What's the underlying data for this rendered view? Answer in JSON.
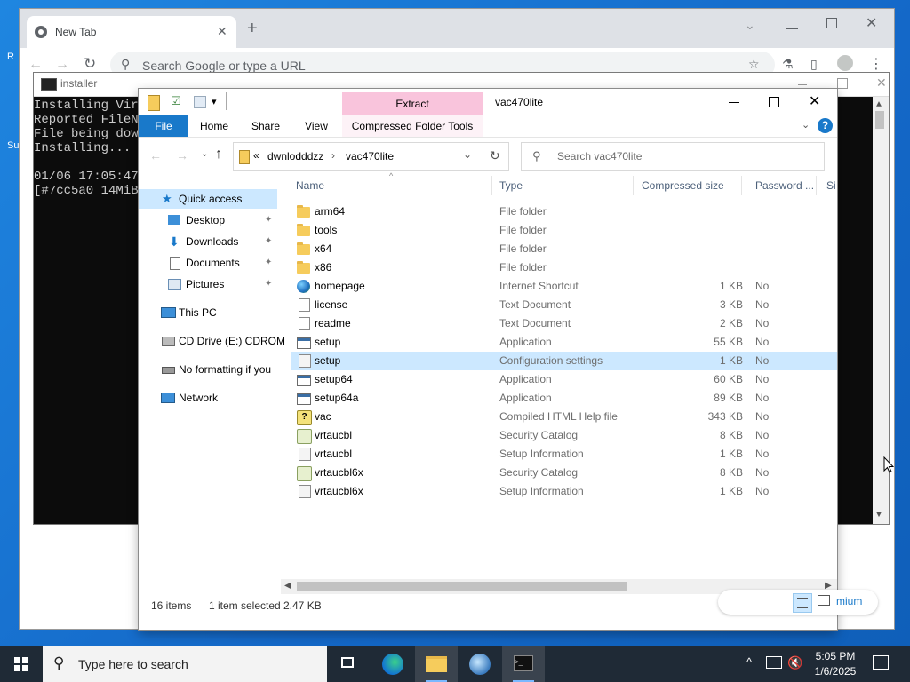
{
  "desktop": {
    "icon_fragment_1": "R",
    "icon_fragment_2": "Su"
  },
  "chrome": {
    "tab_title": "New Tab",
    "omnibox_placeholder": "Search Google or type a URL"
  },
  "cmd": {
    "title": "installer",
    "lines": [
      "Installing Virt",
      "Reported FileNa",
      "File being down",
      "Installing...",
      "",
      "01/06 17:05:47",
      "[#7cc5a0 14MiB/"
    ]
  },
  "explorer": {
    "title": "vac470lite",
    "ribbon": {
      "context_group": "Extract",
      "tabs": [
        "File",
        "Home",
        "Share",
        "View",
        "Compressed Folder Tools"
      ]
    },
    "address": {
      "prefix": "«",
      "crumbs": [
        "dwnlodddzz",
        "vac470lite"
      ]
    },
    "search_placeholder": "Search vac470lite",
    "nav": {
      "quick_access": "Quick access",
      "pinned": [
        "Desktop",
        "Downloads",
        "Documents",
        "Pictures"
      ],
      "this_pc": "This PC",
      "cd_drive": "CD Drive (E:) CDROM",
      "no_format": "No formatting if you",
      "network": "Network"
    },
    "columns": [
      "Name",
      "Type",
      "Compressed size",
      "Password ...",
      "Si"
    ],
    "files": [
      {
        "name": "arm64",
        "type": "File folder",
        "size": "",
        "password": "",
        "icon": "folder-icon"
      },
      {
        "name": "tools",
        "type": "File folder",
        "size": "",
        "password": "",
        "icon": "folder-icon"
      },
      {
        "name": "x64",
        "type": "File folder",
        "size": "",
        "password": "",
        "icon": "folder-icon"
      },
      {
        "name": "x86",
        "type": "File folder",
        "size": "",
        "password": "",
        "icon": "folder-icon"
      },
      {
        "name": "homepage",
        "type": "Internet Shortcut",
        "size": "1 KB",
        "password": "No",
        "icon": "internet-shortcut-icon"
      },
      {
        "name": "license",
        "type": "Text Document",
        "size": "3 KB",
        "password": "No",
        "icon": "text-document-icon"
      },
      {
        "name": "readme",
        "type": "Text Document",
        "size": "2 KB",
        "password": "No",
        "icon": "text-document-icon"
      },
      {
        "name": "setup",
        "type": "Application",
        "size": "55 KB",
        "password": "No",
        "icon": "application-icon"
      },
      {
        "name": "setup",
        "type": "Configuration settings",
        "size": "1 KB",
        "password": "No",
        "icon": "config-settings-icon"
      },
      {
        "name": "setup64",
        "type": "Application",
        "size": "60 KB",
        "password": "No",
        "icon": "application-icon"
      },
      {
        "name": "setup64a",
        "type": "Application",
        "size": "89 KB",
        "password": "No",
        "icon": "application-icon"
      },
      {
        "name": "vac",
        "type": "Compiled HTML Help file",
        "size": "343 KB",
        "password": "No",
        "icon": "help-file-icon"
      },
      {
        "name": "vrtaucbl",
        "type": "Security Catalog",
        "size": "8 KB",
        "password": "No",
        "icon": "security-catalog-icon"
      },
      {
        "name": "vrtaucbl",
        "type": "Setup Information",
        "size": "1 KB",
        "password": "No",
        "icon": "setup-information-icon"
      },
      {
        "name": "vrtaucbl6x",
        "type": "Security Catalog",
        "size": "8 KB",
        "password": "No",
        "icon": "security-catalog-icon"
      },
      {
        "name": "vrtaucbl6x",
        "type": "Setup Information",
        "size": "1 KB",
        "password": "No",
        "icon": "setup-information-icon"
      }
    ],
    "selected_index": 8,
    "status": {
      "items": "16 items",
      "selected": "1 item selected",
      "size": "2.47 KB"
    },
    "view_fragment": "mium"
  },
  "taskbar": {
    "search_placeholder": "Type here to search",
    "time": "5:05 PM",
    "date": "1/6/2025"
  },
  "colors": {
    "accent": "#0063b1",
    "selection": "#cce8ff",
    "context_tab": "#f9c4dc",
    "taskbar": "#1f2a36"
  }
}
